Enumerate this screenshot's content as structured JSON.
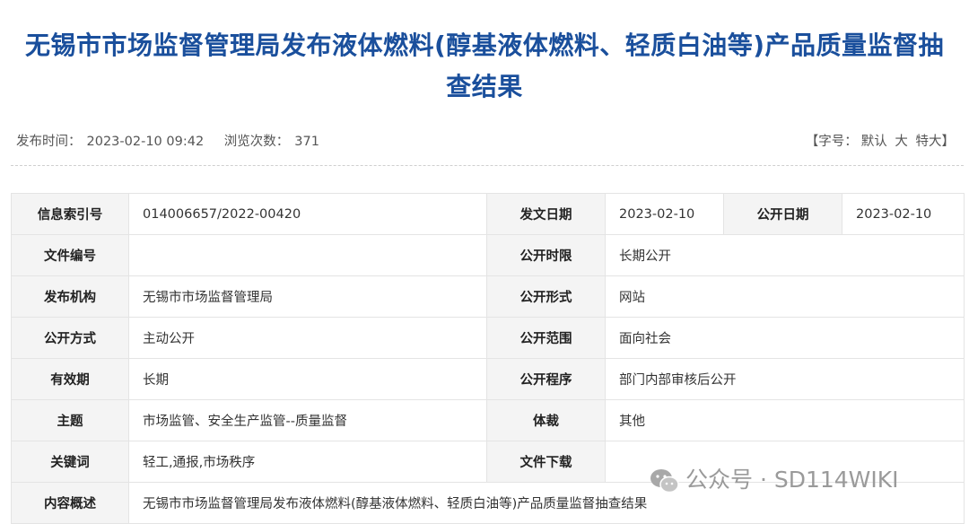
{
  "page": {
    "title": "无锡市市场监督管理局发布液体燃料(醇基液体燃料、轻质白油等)产品质量监督抽查结果"
  },
  "meta": {
    "publish_time_label": "发布时间：",
    "publish_time": "2023-02-10 09:42",
    "views_label": "浏览次数：",
    "views": "371",
    "font_size_label": "【字号：",
    "font_default": "默认",
    "font_large": "大",
    "font_xlarge": "特大",
    "font_size_close": "】"
  },
  "info": {
    "index_no_label": "信息索引号",
    "index_no": "014006657/2022-00420",
    "issue_date_label": "发文日期",
    "issue_date": "2023-02-10",
    "open_date_label": "公开日期",
    "open_date": "2023-02-10",
    "doc_no_label": "文件编号",
    "doc_no": "",
    "open_period_label": "公开时限",
    "open_period": "长期公开",
    "publisher_label": "发布机构",
    "publisher": "无锡市市场监督管理局",
    "open_form_label": "公开形式",
    "open_form": "网站",
    "open_method_label": "公开方式",
    "open_method": "主动公开",
    "open_scope_label": "公开范围",
    "open_scope": "面向社会",
    "validity_label": "有效期",
    "validity": "长期",
    "open_procedure_label": "公开程序",
    "open_procedure": "部门内部审核后公开",
    "topic_label": "主题",
    "topic": "市场监管、安全生产监管--质量监督",
    "genre_label": "体裁",
    "genre": "其他",
    "keywords_label": "关键词",
    "keywords": "轻工,通报,市场秩序",
    "download_label": "文件下载",
    "summary_label": "内容概述",
    "summary": "无锡市市场监督管理局发布液体燃料(醇基液体燃料、轻质白油等)产品质量监督抽查结果"
  },
  "watermark": {
    "text": "公众号 · SD114WIKI",
    "icon": "wechat-icon"
  }
}
